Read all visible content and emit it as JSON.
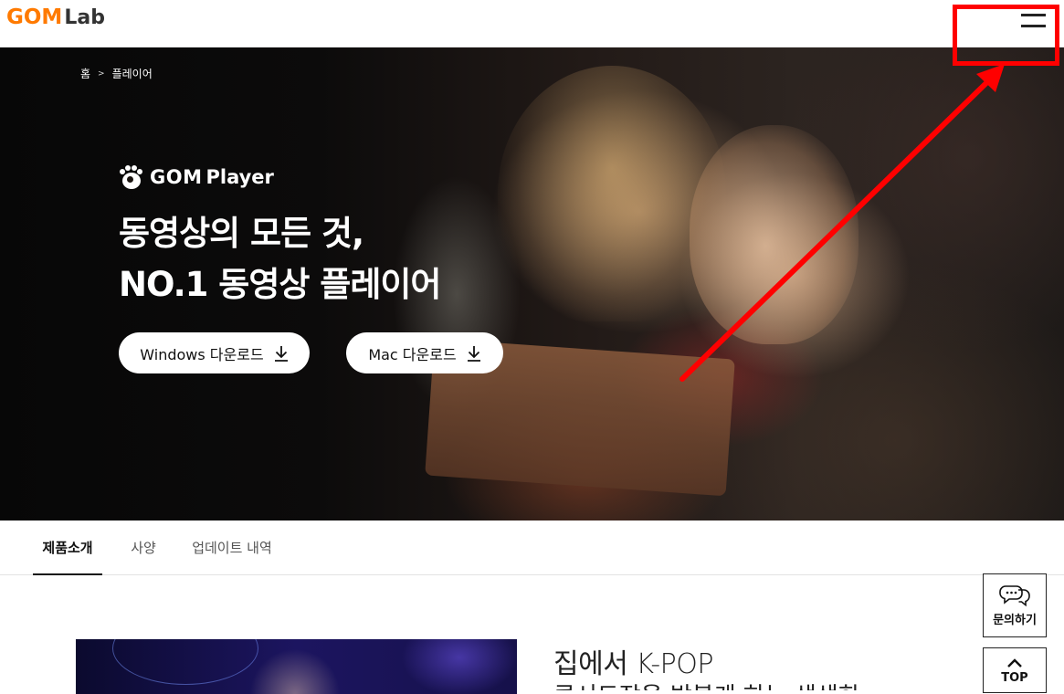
{
  "header": {
    "logo_gom": "GOM",
    "logo_lab": "Lab",
    "menu_icon": "hamburger-menu-icon"
  },
  "breadcrumb": {
    "home": "홈",
    "separator": ">",
    "current": "플레이어"
  },
  "hero": {
    "product_gom": "GOM",
    "product_player": "Player",
    "headline_line1": "동영상의 모든 것,",
    "headline_line2": "NO.1 동영상 플레이어",
    "windows_download": "Windows 다운로드",
    "mac_download": "Mac 다운로드",
    "download_icon": "download-arrow-icon"
  },
  "tabs": [
    {
      "label": "제품소개",
      "active": true
    },
    {
      "label": "사양",
      "active": false
    },
    {
      "label": "업데이트 내역",
      "active": false
    }
  ],
  "section": {
    "title": "집에서 K-POP",
    "subtitle": "콘서트장을 방불케 하는 생생한"
  },
  "floating": {
    "inquiry_label": "문의하기",
    "inquiry_icon": "chat-bubbles-icon",
    "top_label": "TOP",
    "top_icon": "chevron-up-icon"
  },
  "colors": {
    "brand_orange": "#ff7a00",
    "annotation_red": "#ff0000"
  }
}
